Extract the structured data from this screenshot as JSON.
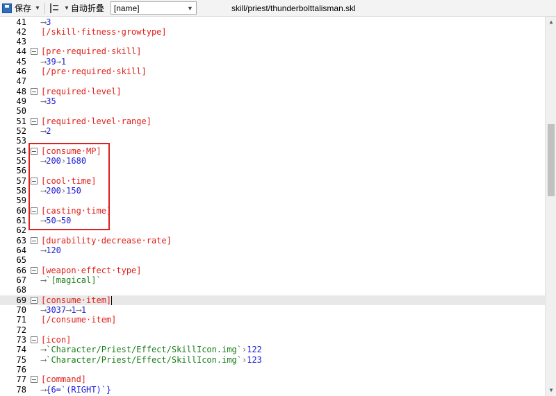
{
  "toolbar": {
    "save_label": "保存",
    "fold_label": "自动折叠",
    "combo_value": "[name]",
    "file_path": "skill/priest/thunderbolttalisman.skl"
  },
  "lines": [
    {
      "n": "41",
      "fold": false,
      "parts": [
        {
          "t": "arr",
          "v": "⟶"
        },
        {
          "t": "num",
          "v": "3"
        }
      ]
    },
    {
      "n": "42",
      "fold": false,
      "parts": [
        {
          "t": "tag",
          "v": "[/skill·fitness·growtype]"
        }
      ]
    },
    {
      "n": "43",
      "fold": false,
      "parts": []
    },
    {
      "n": "44",
      "fold": true,
      "parts": [
        {
          "t": "tag",
          "v": "[pre·required·skill]"
        }
      ]
    },
    {
      "n": "45",
      "fold": false,
      "parts": [
        {
          "t": "arr",
          "v": "⟶"
        },
        {
          "t": "num",
          "v": "39"
        },
        {
          "t": "arr",
          "v": "→"
        },
        {
          "t": "num",
          "v": "1"
        }
      ]
    },
    {
      "n": "46",
      "fold": false,
      "parts": [
        {
          "t": "tag",
          "v": "[/pre·required·skill]"
        }
      ]
    },
    {
      "n": "47",
      "fold": false,
      "parts": []
    },
    {
      "n": "48",
      "fold": true,
      "parts": [
        {
          "t": "tag",
          "v": "[required·level]"
        }
      ]
    },
    {
      "n": "49",
      "fold": false,
      "parts": [
        {
          "t": "arr",
          "v": "⟶"
        },
        {
          "t": "num",
          "v": "35"
        }
      ]
    },
    {
      "n": "50",
      "fold": false,
      "parts": []
    },
    {
      "n": "51",
      "fold": true,
      "parts": [
        {
          "t": "tag",
          "v": "[required·level·range]"
        }
      ]
    },
    {
      "n": "52",
      "fold": false,
      "parts": [
        {
          "t": "arr",
          "v": "⟶"
        },
        {
          "t": "num",
          "v": "2"
        }
      ]
    },
    {
      "n": "53",
      "fold": false,
      "parts": []
    },
    {
      "n": "54",
      "fold": true,
      "parts": [
        {
          "t": "tag",
          "v": "[consume·MP]"
        }
      ]
    },
    {
      "n": "55",
      "fold": false,
      "parts": [
        {
          "t": "arr",
          "v": "⟶"
        },
        {
          "t": "num",
          "v": "200"
        },
        {
          "t": "arr",
          "v": "›"
        },
        {
          "t": "num",
          "v": "1680"
        }
      ]
    },
    {
      "n": "56",
      "fold": false,
      "parts": []
    },
    {
      "n": "57",
      "fold": true,
      "parts": [
        {
          "t": "tag",
          "v": "[cool·time]"
        }
      ]
    },
    {
      "n": "58",
      "fold": false,
      "parts": [
        {
          "t": "arr",
          "v": "⟶"
        },
        {
          "t": "num",
          "v": "200"
        },
        {
          "t": "arr",
          "v": "›"
        },
        {
          "t": "num",
          "v": "150"
        }
      ]
    },
    {
      "n": "59",
      "fold": false,
      "parts": []
    },
    {
      "n": "60",
      "fold": true,
      "parts": [
        {
          "t": "tag",
          "v": "[casting·time]"
        }
      ]
    },
    {
      "n": "61",
      "fold": false,
      "parts": [
        {
          "t": "arr",
          "v": "⟶"
        },
        {
          "t": "num",
          "v": "50"
        },
        {
          "t": "arr",
          "v": "→"
        },
        {
          "t": "num",
          "v": "50"
        }
      ]
    },
    {
      "n": "62",
      "fold": false,
      "parts": []
    },
    {
      "n": "63",
      "fold": true,
      "parts": [
        {
          "t": "tag",
          "v": "[durability·decrease·rate]"
        }
      ]
    },
    {
      "n": "64",
      "fold": false,
      "parts": [
        {
          "t": "arr",
          "v": "⟶"
        },
        {
          "t": "num",
          "v": "120"
        }
      ]
    },
    {
      "n": "65",
      "fold": false,
      "parts": []
    },
    {
      "n": "66",
      "fold": true,
      "parts": [
        {
          "t": "tag",
          "v": "[weapon·effect·type]"
        }
      ]
    },
    {
      "n": "67",
      "fold": false,
      "parts": [
        {
          "t": "arr",
          "v": "⟶"
        },
        {
          "t": "str",
          "v": "`[magical]`"
        }
      ]
    },
    {
      "n": "68",
      "fold": false,
      "parts": []
    },
    {
      "n": "69",
      "fold": true,
      "current": true,
      "parts": [
        {
          "t": "tag",
          "v": "[consume·item]"
        },
        {
          "t": "caret",
          "v": ""
        }
      ]
    },
    {
      "n": "70",
      "fold": false,
      "parts": [
        {
          "t": "arr",
          "v": "⟶"
        },
        {
          "t": "num",
          "v": "3037"
        },
        {
          "t": "arr",
          "v": "⟶"
        },
        {
          "t": "num",
          "v": "1"
        },
        {
          "t": "arr",
          "v": "⟶"
        },
        {
          "t": "num",
          "v": "1"
        }
      ]
    },
    {
      "n": "71",
      "fold": false,
      "parts": [
        {
          "t": "tag",
          "v": "[/consume·item]"
        }
      ]
    },
    {
      "n": "72",
      "fold": false,
      "parts": []
    },
    {
      "n": "73",
      "fold": true,
      "parts": [
        {
          "t": "tag",
          "v": "[icon]"
        }
      ]
    },
    {
      "n": "74",
      "fold": false,
      "parts": [
        {
          "t": "arr",
          "v": "⟶"
        },
        {
          "t": "str",
          "v": "`Character/Priest/Effect/SkillIcon.img`"
        },
        {
          "t": "arr",
          "v": "›"
        },
        {
          "t": "num",
          "v": "122"
        }
      ]
    },
    {
      "n": "75",
      "fold": false,
      "parts": [
        {
          "t": "arr",
          "v": "⟶"
        },
        {
          "t": "str",
          "v": "`Character/Priest/Effect/SkillIcon.img`"
        },
        {
          "t": "arr",
          "v": "›"
        },
        {
          "t": "num",
          "v": "123"
        }
      ]
    },
    {
      "n": "76",
      "fold": false,
      "parts": []
    },
    {
      "n": "77",
      "fold": true,
      "parts": [
        {
          "t": "tag",
          "v": "[command]"
        }
      ]
    },
    {
      "n": "78",
      "fold": false,
      "parts": [
        {
          "t": "arr",
          "v": "⟶"
        },
        {
          "t": "num",
          "v": "{6=`(RIGHT)`}"
        }
      ]
    }
  ]
}
